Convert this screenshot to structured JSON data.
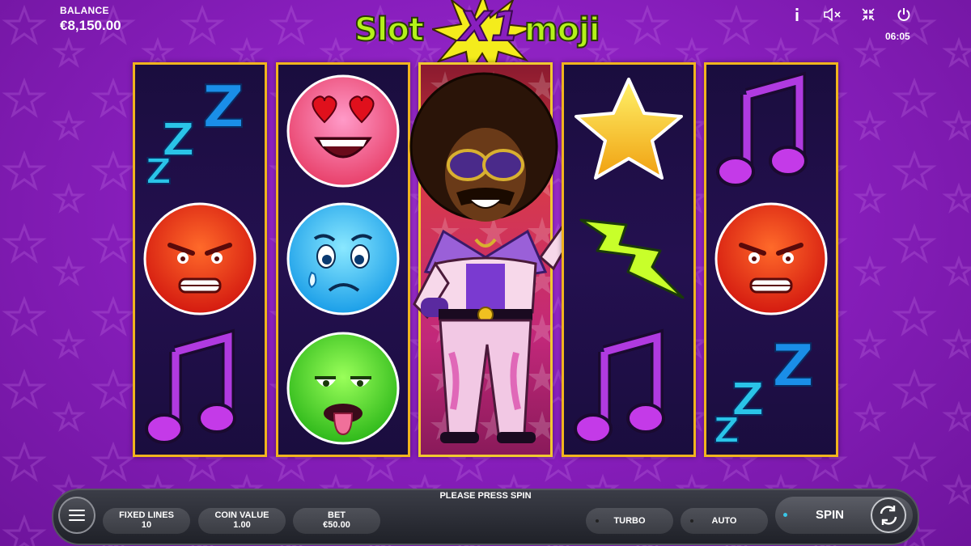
{
  "game": {
    "title_part1": "Slot",
    "title_x": "X1",
    "title_part2": "moji"
  },
  "balance": {
    "label": "BALANCE",
    "value": "€8,150.00"
  },
  "topbar": {
    "info_icon": "info-icon",
    "mute_icon": "mute-icon",
    "fullscreen_icon": "exit-fullscreen-icon",
    "power_icon": "power-icon",
    "clock": "06:05"
  },
  "reels": [
    {
      "symbols": [
        "zzz",
        "angry-face",
        "music-note"
      ]
    },
    {
      "symbols": [
        "heart-eyes-face",
        "crying-face",
        "sick-face"
      ]
    },
    {
      "symbols": [
        "disco-character-wild"
      ]
    },
    {
      "symbols": [
        "star",
        "lightning-bolt",
        "music-note"
      ]
    },
    {
      "symbols": [
        "music-note",
        "angry-face",
        "zzz"
      ]
    }
  ],
  "controls": {
    "status": "PLEASE PRESS SPIN",
    "fixed_lines": {
      "label": "FIXED LINES",
      "value": "10"
    },
    "coin_value": {
      "label": "COIN VALUE",
      "value": "1.00"
    },
    "bet": {
      "label": "BET",
      "value": "€50.00"
    },
    "turbo": "TURBO",
    "auto": "AUTO",
    "spin": "SPIN"
  },
  "colors": {
    "reel_border": "#f0b41e",
    "background": "#8a1fbf",
    "logo_green": "#b4f21a",
    "accent_cyan": "#39c6e6"
  }
}
